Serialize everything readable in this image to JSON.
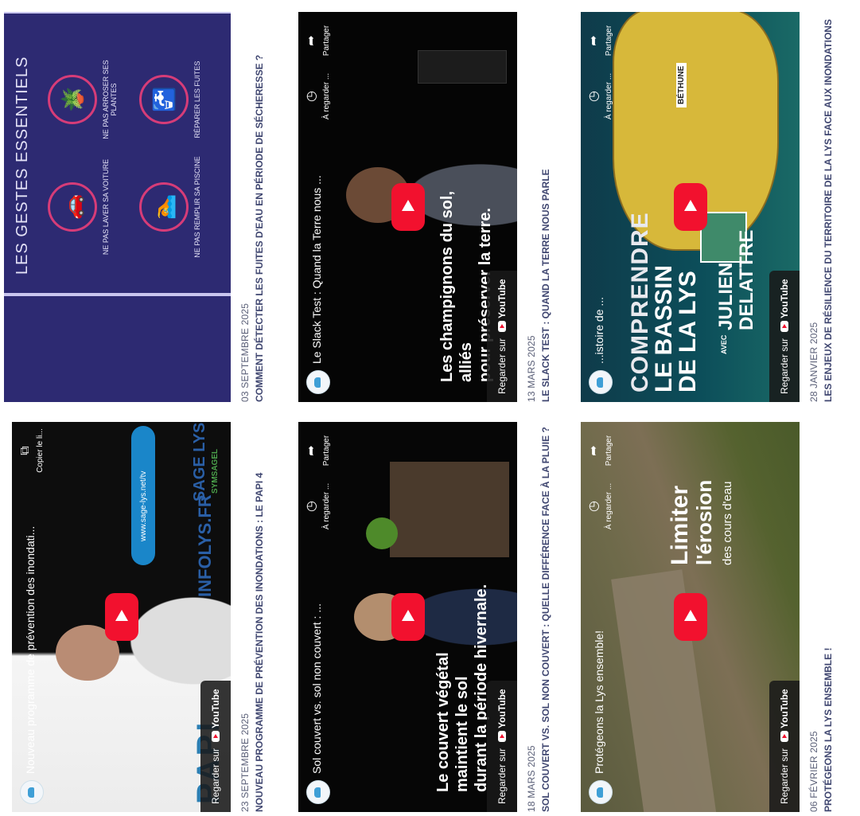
{
  "cards": [
    {
      "date": "23 SEPTEMBRE 2025",
      "title": "NOUVEAU PROGRAMME DE PRÉVENTION DES INONDATIONS : LE PAPI 4",
      "video_title": "Nouveau programme de prévention des inondati...",
      "action": "Copier le li...",
      "watch": "Regarder sur",
      "yt": "YouTube",
      "url": "www.sage-lys.net/tv",
      "logo1": "INFOLYS.FR",
      "logo2": "SAGE LYS",
      "logo2_sub": "SYMSAGEL",
      "papi": "PAPI"
    },
    {
      "date": "03 SEPTEMBRE 2025",
      "title": "COMMENT DÉTECTER LES FUITES D'EAU EN PÉRIODE DE SÉCHERESSE ?",
      "header": "LES GESTES ESSENTIELS",
      "gestes": [
        "NE PAS LAVER SA VOITURE",
        "NE PAS ARROSER SES PLANTES",
        "NE PAS REMPLIR SA PISCINE",
        "RÉPARER LES FUITES"
      ]
    },
    {
      "date": "18 MARS 2025",
      "title": "SOL COUVERT VS. SOL NON COUVERT : QUELLE DIFFÉRENCE FACE À LA PLUIE ?",
      "video_title": "Sol couvert vs. sol non couvert : ...",
      "a1": "À regarder ...",
      "a2": "Partager",
      "watch": "Regarder sur",
      "yt": "YouTube",
      "overlay": [
        "Le couvert végétal",
        "maintient le sol",
        "durant la période hivernale."
      ]
    },
    {
      "date": "13 MARS 2025",
      "title": "LE SLACK TEST : QUAND LA TERRE NOUS PARLE",
      "video_title": "Le Slack Test : Quand la Terre nous ...",
      "a1": "À regarder ...",
      "a2": "Partager",
      "watch": "Regarder sur",
      "yt": "YouTube",
      "overlay": [
        "Les champignons du sol,",
        "alliés",
        "pour préserver la terre."
      ]
    },
    {
      "date": "06 FÉVRIER 2025",
      "title": "PROTÉGEONS LA LYS ENSEMBLE !",
      "video_title": "Protégeons la Lys ensemble!",
      "a1": "À regarder ...",
      "a2": "Partager",
      "watch": "Regarder sur",
      "yt": "YouTube",
      "overlay": [
        "Limiter",
        "l'érosion",
        "des cours d'eau"
      ]
    },
    {
      "date": "28 JANVIER 2025",
      "title": "LES ENJEUX DE RÉSILIENCE DU TERRITOIRE DE LA LYS FACE AUX INONDATIONS",
      "video_title": "...istoire de ...",
      "a1": "À regarder ...",
      "a2": "Partager",
      "watch": "Regarder sur",
      "yt": "YouTube",
      "overlay": [
        "COMPRENDRE",
        "LE BASSIN",
        "DE LA LYS"
      ],
      "avec": "AVEC",
      "name": [
        "JULIEN",
        "DELATTRE"
      ],
      "map_label": "BÉTHUNE"
    }
  ],
  "colors": {
    "navy": "#2d2a72",
    "yt_red": "#f2112e",
    "caption": "#3f4670"
  }
}
